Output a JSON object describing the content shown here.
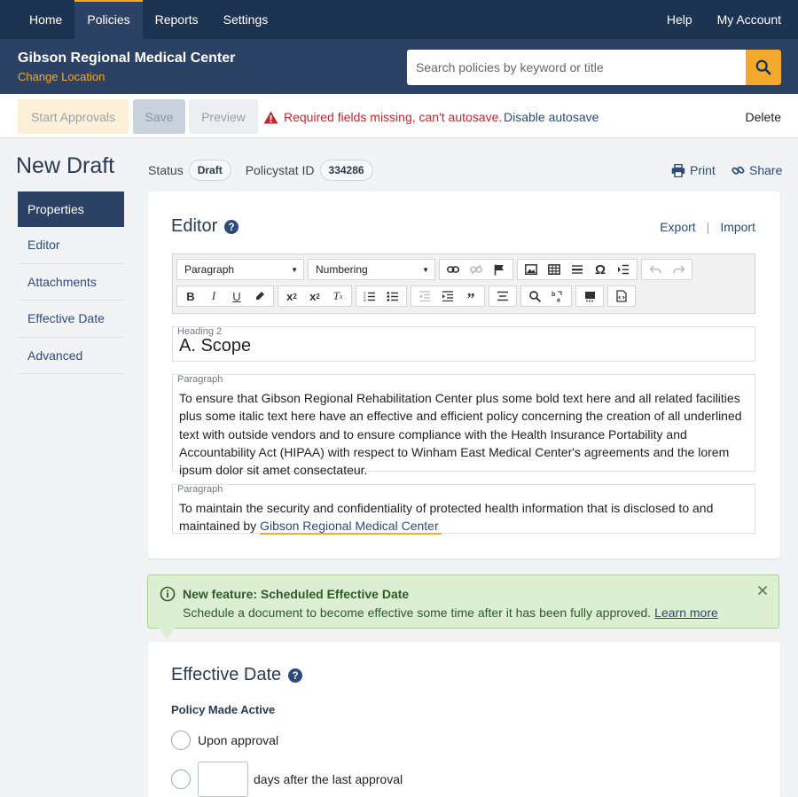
{
  "topnav": {
    "left": [
      "Home",
      "Policies",
      "Reports",
      "Settings"
    ],
    "right": [
      "Help",
      "My Account"
    ],
    "active": "Policies"
  },
  "org": {
    "name": "Gibson Regional Medical Center",
    "change_location": "Change Location"
  },
  "search": {
    "placeholder": "Search policies by keyword or title",
    "icon": "search-icon"
  },
  "toolbar": {
    "start_approvals": "Start Approvals",
    "save": "Save",
    "preview": "Preview",
    "warning": "Required fields missing, can't autosave.",
    "disable_autosave": "Disable autosave",
    "delete": "Delete"
  },
  "page": {
    "title": "New Draft"
  },
  "sidebar": {
    "items": [
      "Properties",
      "Editor",
      "Attachments",
      "Effective Date",
      "Advanced"
    ],
    "active": "Properties"
  },
  "status": {
    "status_label": "Status",
    "status_value": "Draft",
    "policy_id_label": "Policystat ID",
    "policy_id_value": "334286",
    "print": "Print",
    "share": "Share"
  },
  "editor": {
    "title": "Editor",
    "export": "Export",
    "sep": "|",
    "import": "Import",
    "format_select": "Paragraph",
    "numbering_select": "Numbering",
    "blocks": {
      "heading_label": "Heading 2",
      "heading_text": "A. Scope",
      "p1_label": "Paragraph",
      "p1_text": "To ensure that Gibson Regional Rehabilitation Center plus some bold text here and all related facilities plus some italic text here have an effective and efficient policy concerning the creation of all underlined text with outside vendors and to ensure compliance with the Health Insurance Portability and Accountability Act (HIPAA) with respect to Winham East Medical Center's agreements and the lorem ipsum dolor sit amet consectateur.",
      "p2_label": "Paragraph",
      "p2_text": "To maintain the security and confidentiality of protected health information that is disclosed to and maintained by",
      "p2_link": "Gibson Regional Medical Center"
    }
  },
  "banner": {
    "title": "New feature: Scheduled Effective Date",
    "text": "Schedule a document to become effective some time after it has been fully approved.",
    "link": "Learn more"
  },
  "effective": {
    "title": "Effective Date",
    "subtitle": "Policy Made Active",
    "option_upon": "Upon approval",
    "option_days": "days after the last approval"
  },
  "colors": {
    "nav": "#1d3352",
    "header": "#2c4264",
    "accent": "#f2a92d",
    "warning": "#c4262e",
    "link": "#2c4a7a",
    "banner_bg": "#dcefd3"
  }
}
